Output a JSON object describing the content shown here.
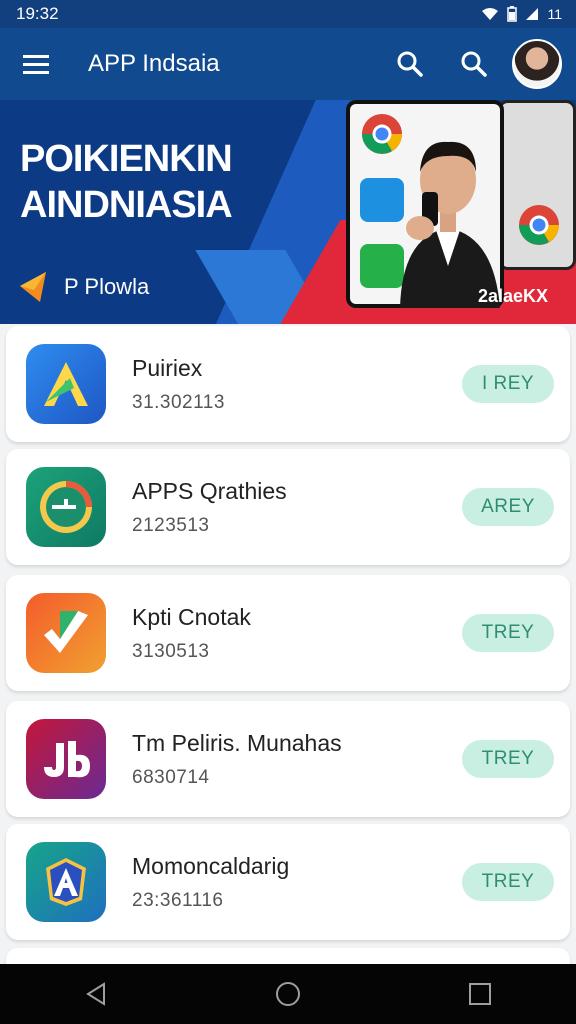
{
  "status_bar": {
    "time": "19:32",
    "right_text": "11"
  },
  "app_bar": {
    "title": "APP Indsaia"
  },
  "banner": {
    "heading_line1": "POIKIENKIN",
    "heading_line2": "AINDNIASIA",
    "brand": "P Plowla",
    "caption": "2alaeKX"
  },
  "apps": [
    {
      "name": "Puiriex",
      "meta": "31.302113",
      "action": "I REY",
      "icon": "arrow-a-icon",
      "colors": [
        "#2e8cf0",
        "#1f57c4"
      ]
    },
    {
      "name": "APPS Qrathies",
      "meta": "2123513",
      "action": "AREY",
      "icon": "clock-icon",
      "colors": [
        "#1ca37a",
        "#0f7a63"
      ]
    },
    {
      "name": "Kpti Cnotak",
      "meta": "3130513",
      "action": "TREY",
      "icon": "check-icon",
      "colors": [
        "#f45c2c",
        "#f08a2a"
      ]
    },
    {
      "name": "Tm Peliris. Munahas",
      "meta": "6830714",
      "action": "TREY",
      "icon": "jb-icon",
      "colors": [
        "#b0173a",
        "#7a1f8a"
      ]
    },
    {
      "name": "Momoncaldarig",
      "meta": "23:361116",
      "action": "TREY",
      "icon": "shield-a-icon",
      "colors": [
        "#17a589",
        "#1f6fbf"
      ]
    }
  ]
}
